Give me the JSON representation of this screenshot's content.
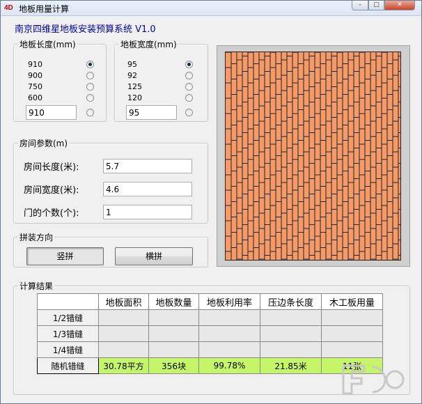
{
  "window": {
    "title": "地板用量计算",
    "icon_text": "4D",
    "buttons": {
      "minimize": "–",
      "maximize": "□",
      "close": "✕"
    }
  },
  "app_heading": "南京四维星地板安装预算系统 V1.0",
  "board_length": {
    "legend": "地板长度(mm)",
    "options": [
      "910",
      "900",
      "750",
      "600"
    ],
    "selected_index": 0,
    "custom_value": "910"
  },
  "board_width": {
    "legend": "地板宽度(mm)",
    "options": [
      "95",
      "92",
      "125",
      "120"
    ],
    "selected_index": 0,
    "custom_value": "95"
  },
  "room": {
    "legend": "房间参数(m)",
    "length_label": "房间长度(米):",
    "length_value": "5.7",
    "width_label": "房间宽度(米):",
    "width_value": "4.6",
    "doors_label": "门的个数(个):",
    "doors_value": "1"
  },
  "direction": {
    "legend": "拼装方向",
    "vertical_label": "竖拼",
    "horizontal_label": "横拼",
    "selected": "vertical"
  },
  "preview": {
    "floor_color": "#f59a69",
    "line_color": "#222222"
  },
  "results": {
    "legend": "计算结果",
    "columns": [
      "地板面积",
      "地板数量",
      "地板利用率",
      "压边条长度",
      "木工板用量"
    ],
    "rows": [
      {
        "label": "1/2错缝",
        "cells": [
          "",
          "",
          "",
          "",
          ""
        ]
      },
      {
        "label": "1/3错缝",
        "cells": [
          "",
          "",
          "",
          "",
          ""
        ]
      },
      {
        "label": "1/4错缝",
        "cells": [
          "",
          "",
          "",
          "",
          ""
        ]
      },
      {
        "label": "随机错缝",
        "cells": [
          "30.78平方",
          "356块",
          "99.78%",
          "21.85米",
          "11张"
        ]
      }
    ],
    "highlight_color": "#c6f56a"
  }
}
